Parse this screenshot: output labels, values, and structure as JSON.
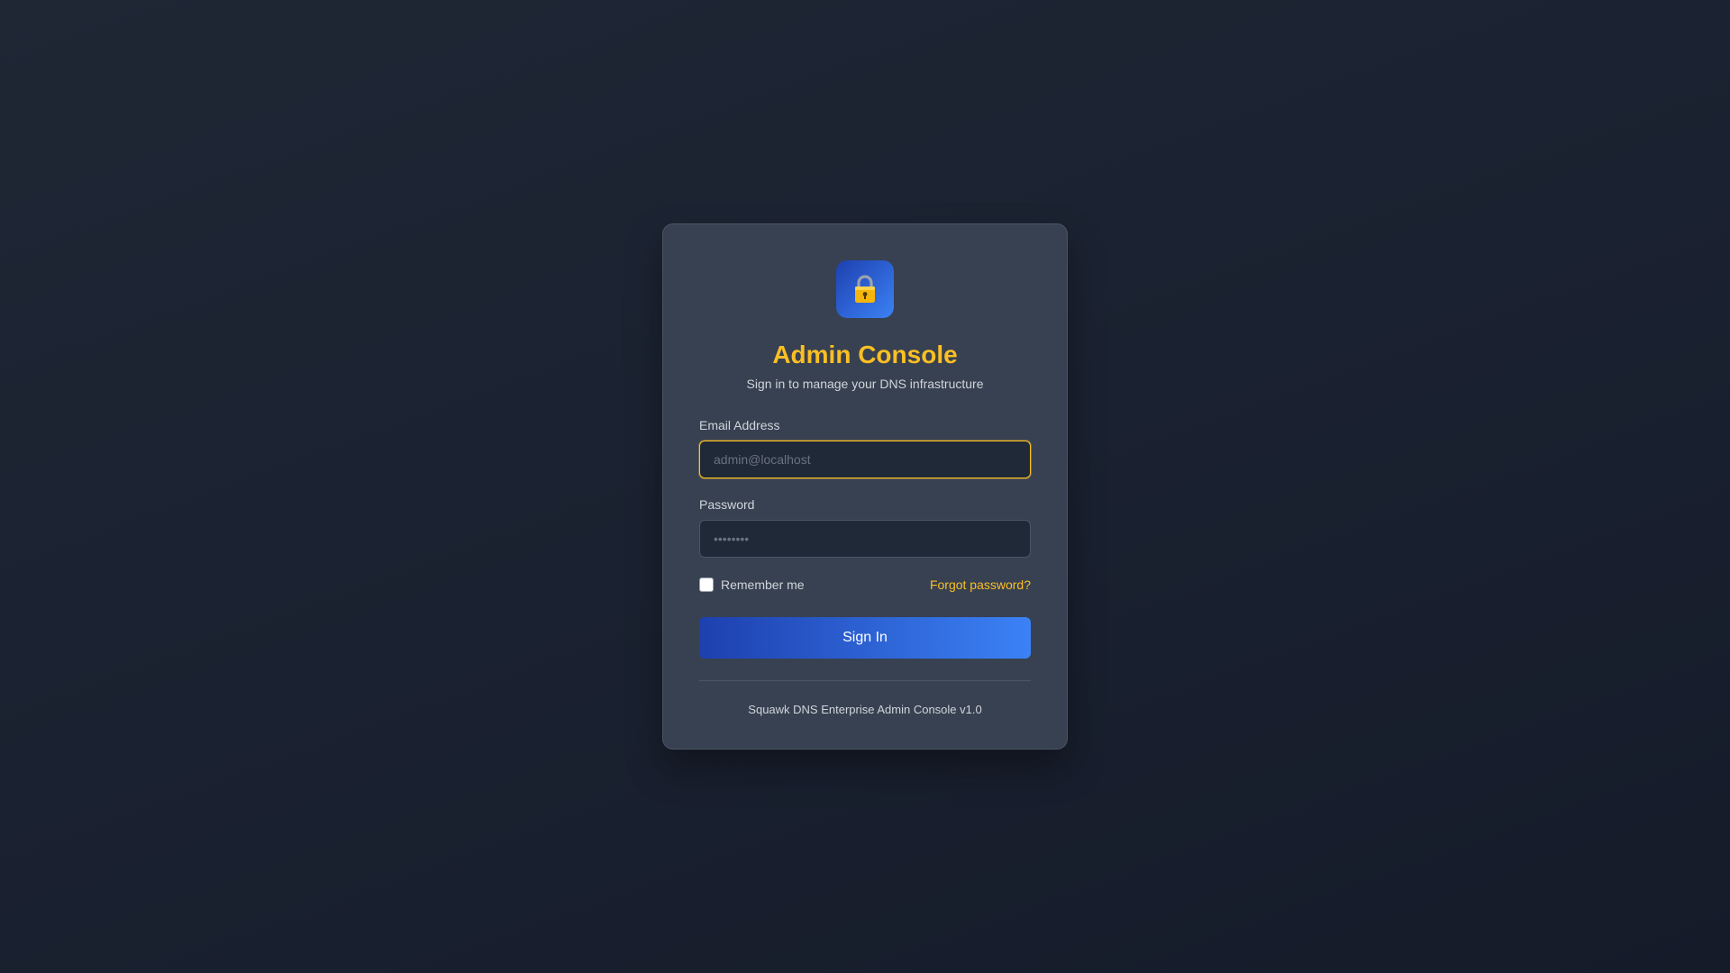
{
  "card": {
    "title": "Admin Console",
    "subtitle": "Sign in to manage your DNS infrastructure",
    "logo_icon": "lock-icon"
  },
  "form": {
    "email_label": "Email Address",
    "email_placeholder": "admin@localhost",
    "email_value": "",
    "password_label": "Password",
    "password_placeholder": "••••••••",
    "password_value": "",
    "remember_label": "Remember me",
    "remember_checked": false,
    "forgot_label": "Forgot password?",
    "submit_label": "Sign In"
  },
  "footer": {
    "text": "Squawk DNS Enterprise Admin Console v1.0"
  },
  "colors": {
    "accent": "#fbbf24",
    "button_start": "#1e40af",
    "button_end": "#3b82f6",
    "card_bg": "#374151",
    "page_bg": "#1a2130"
  }
}
